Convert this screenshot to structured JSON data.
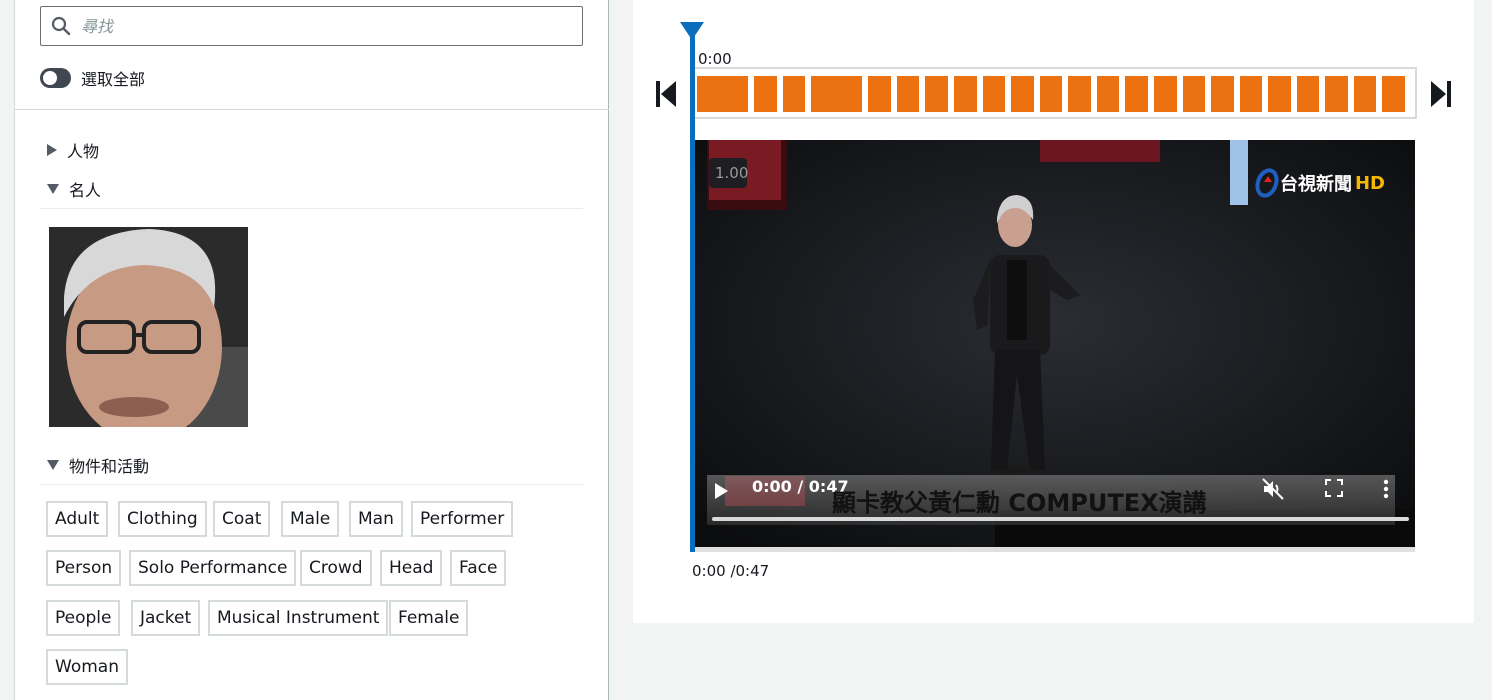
{
  "search": {
    "placeholder": "尋找",
    "value": ""
  },
  "select_all": {
    "label": "選取全部",
    "enabled": false
  },
  "sections": [
    {
      "label": "人物",
      "expanded": false
    },
    {
      "label": "名人",
      "expanded": true
    },
    {
      "label": "物件和活動",
      "expanded": true
    }
  ],
  "tags": [
    "Adult",
    "Clothing",
    "Coat",
    "Male",
    "Man",
    "Performer",
    "Person",
    "Solo Performance",
    "Crowd",
    "Head",
    "Face",
    "People",
    "Jacket",
    "Musical Instrument",
    "Female",
    "Woman"
  ],
  "timeline": {
    "start_label": "0:00",
    "segment_count": 23
  },
  "video": {
    "logo_text": "台視新聞",
    "logo_hd": "HD",
    "time_display": "0:00 / 0:47",
    "caption": "顯卡教父黃仁勳 COMPUTEX演講",
    "muted": true
  },
  "playback": {
    "time_label": "0:00 /0:47"
  },
  "colors": {
    "accent": "#ec7211",
    "playhead": "#0a6ebd"
  }
}
